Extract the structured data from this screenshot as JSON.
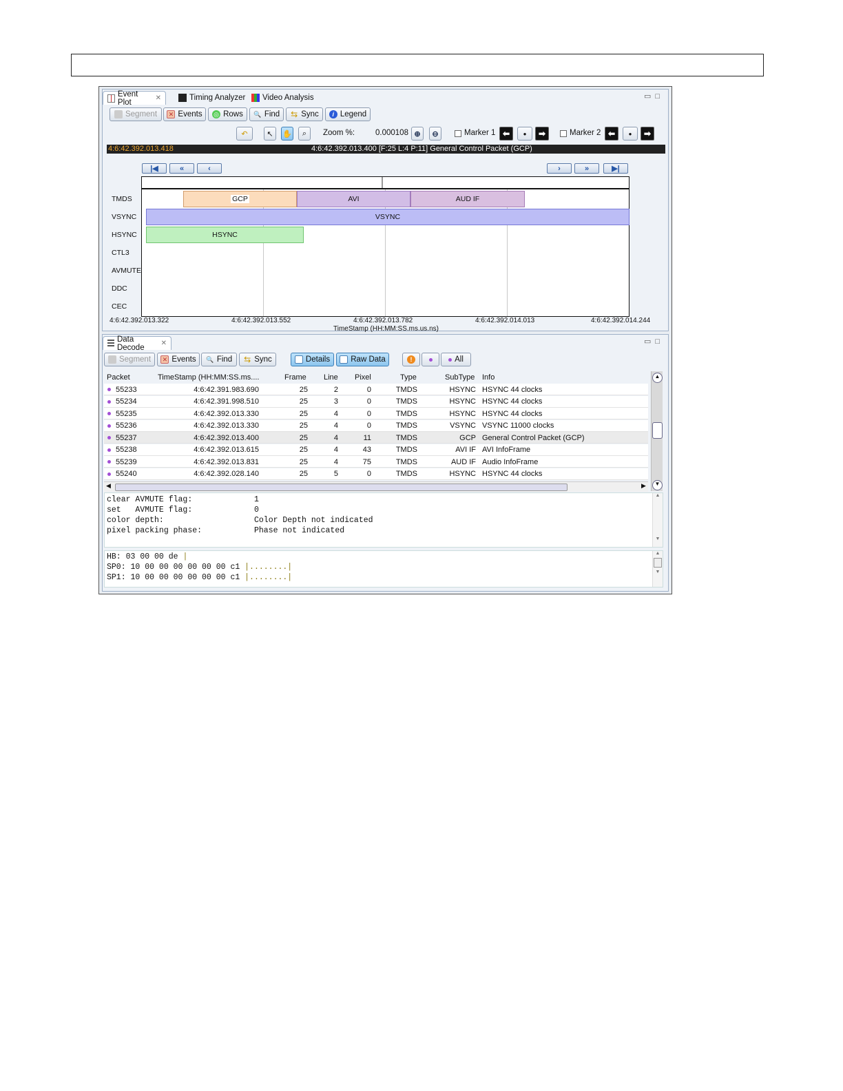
{
  "event_plot": {
    "tabs": [
      {
        "label": "Event Plot"
      },
      {
        "label": "Timing Analyzer"
      },
      {
        "label": "Video Analysis"
      }
    ],
    "toolbar": {
      "segment": "Segment",
      "events": "Events",
      "rows": "Rows",
      "find": "Find",
      "sync": "Sync",
      "legend": "Legend"
    },
    "zoom_label": "Zoom %:",
    "zoom_value": "0.000108",
    "marker1": "Marker 1",
    "marker2": "Marker 2",
    "cursor_time": "4:6:42.392.013.418",
    "status_text": "4:6:42.392.013.400 [F:25 L:4 P:11] General Control Packet (GCP)",
    "row_labels": [
      "TMDS",
      "VSYNC",
      "HSYNC",
      "CTL3",
      "AVMUTE",
      "DDC",
      "CEC"
    ],
    "bars": {
      "gcp": "GCP",
      "avi": "AVI",
      "audif": "AUD IF",
      "vsync": "VSYNC",
      "hsync": "HSYNC"
    },
    "x_ticks": [
      "4:6:42.392.013.322",
      "4:6:42.392.013.552",
      "4:6:42.392.013.782",
      "4:6:42.392.014.013",
      "4:6:42.392.014.244"
    ],
    "x_title": "TimeStamp (HH:MM:SS.ms.us.ns)"
  },
  "data_decode": {
    "tab": "Data Decode",
    "toolbar": {
      "segment": "Segment",
      "events": "Events",
      "find": "Find",
      "sync": "Sync",
      "details": "Details",
      "raw_data": "Raw Data",
      "all": "All"
    },
    "columns": [
      "Packet",
      "TimeStamp (HH:MM:SS.ms....",
      "Frame",
      "Line",
      "Pixel",
      "Type",
      "SubType",
      "Info"
    ],
    "rows": [
      {
        "packet": "55233",
        "ts": "4:6:42.391.983.690",
        "frame": "25",
        "line": "2",
        "pixel": "0",
        "type": "TMDS",
        "subtype": "HSYNC",
        "info": "HSYNC 44 clocks"
      },
      {
        "packet": "55234",
        "ts": "4:6:42.391.998.510",
        "frame": "25",
        "line": "3",
        "pixel": "0",
        "type": "TMDS",
        "subtype": "HSYNC",
        "info": "HSYNC 44 clocks"
      },
      {
        "packet": "55235",
        "ts": "4:6:42.392.013.330",
        "frame": "25",
        "line": "4",
        "pixel": "0",
        "type": "TMDS",
        "subtype": "HSYNC",
        "info": "HSYNC 44 clocks"
      },
      {
        "packet": "55236",
        "ts": "4:6:42.392.013.330",
        "frame": "25",
        "line": "4",
        "pixel": "0",
        "type": "TMDS",
        "subtype": "VSYNC",
        "info": "VSYNC 11000 clocks"
      },
      {
        "packet": "55237",
        "ts": "4:6:42.392.013.400",
        "frame": "25",
        "line": "4",
        "pixel": "11",
        "type": "TMDS",
        "subtype": "GCP",
        "info": "General Control Packet (GCP)"
      },
      {
        "packet": "55238",
        "ts": "4:6:42.392.013.615",
        "frame": "25",
        "line": "4",
        "pixel": "43",
        "type": "TMDS",
        "subtype": "AVI IF",
        "info": "AVI InfoFrame"
      },
      {
        "packet": "55239",
        "ts": "4:6:42.392.013.831",
        "frame": "25",
        "line": "4",
        "pixel": "75",
        "type": "TMDS",
        "subtype": "AUD IF",
        "info": "Audio InfoFrame"
      },
      {
        "packet": "55240",
        "ts": "4:6:42.392.028.140",
        "frame": "25",
        "line": "5",
        "pixel": "0",
        "type": "TMDS",
        "subtype": "HSYNC",
        "info": "HSYNC 44 clocks"
      }
    ],
    "details": [
      {
        "field": "clear AVMUTE flag:",
        "value": "1"
      },
      {
        "field": "set   AVMUTE flag:",
        "value": "0"
      },
      {
        "field": "color depth:",
        "value": "Color Depth not indicated"
      },
      {
        "field": "pixel packing phase:",
        "value": "Phase not indicated"
      }
    ],
    "raw": [
      {
        "label": "HB:",
        "bytes": "03 00 00 de",
        "ascii": "|"
      },
      {
        "label": "SP0:",
        "bytes": "10 00 00 00 00 00 00 c1",
        "ascii": "|........|"
      },
      {
        "label": "SP1:",
        "bytes": "10 00 00 00 00 00 00 c1",
        "ascii": "|........|"
      }
    ]
  }
}
